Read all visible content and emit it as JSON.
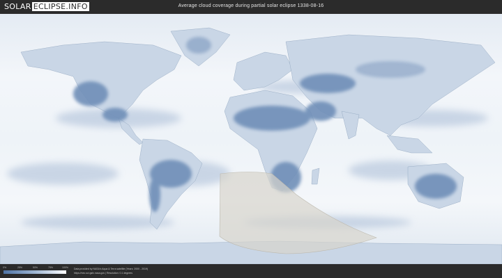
{
  "header": {
    "logo_part_a": "SOLAR",
    "logo_part_b": "ECLIPSE.INFO",
    "title": "Average cloud coverage during partial solar eclipse 1338-08-16"
  },
  "legend": {
    "ticks": [
      "0%",
      "25%",
      "50%",
      "75%",
      "100%"
    ],
    "colors": {
      "clear": "#4f74a6",
      "mid": "#9fb6d2",
      "cloudy": "#ffffff"
    }
  },
  "footer": {
    "credit_line_1": "Data provided by NASA's Aqua & Terra satellite (Years: 2000 - 2019)",
    "credit_line_2": "https://neo.sci.gsfc.nasa.gov | Resolution: 0.1 degrees"
  },
  "map": {
    "colors": {
      "ocean_cloud": "#eef3f8",
      "land_clear": "#6f8fb8",
      "eclipse_zone": "#d7d4cc"
    }
  }
}
